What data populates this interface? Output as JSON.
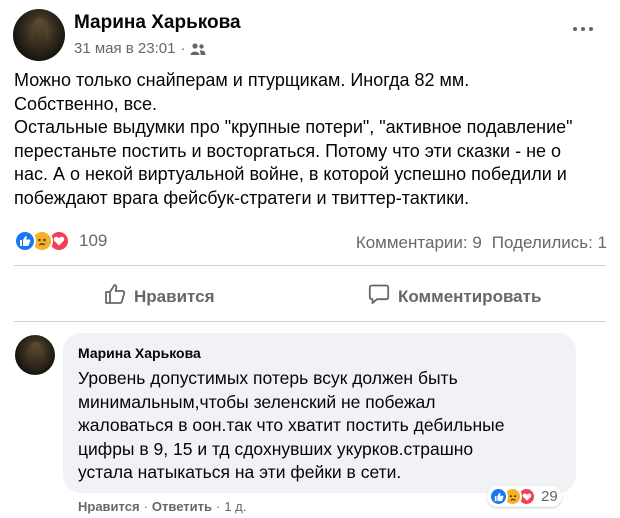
{
  "post": {
    "author": "Марина Харькова",
    "date": "31 мая в 23:01",
    "separator": "·",
    "audience_icon": "friends-icon",
    "text_lines": [
      "Можно только снайперам и птурщикам. Иногда 82 мм.",
      "Собственно, все.",
      "Остальные выдумки про \"крупные потери\", \"активное подавление\"",
      "перестаньте постить и восторгаться. Потому что эти сказки - не о",
      "нас. А о некой виртуальной войне, в которой успешно победили и",
      "побеждают врага фейсбук-стратеги и твиттер-тактики."
    ],
    "reactions": {
      "icons": [
        "like-icon",
        "sad-icon",
        "love-icon"
      ],
      "count": "109"
    },
    "comments_label": "Комментарии: 9",
    "shares_label": "Поделились: 1",
    "like_label": "Нравится",
    "comment_label": "Комментировать"
  },
  "comment": {
    "author": "Марина Харькова",
    "text_lines": [
      "Уровень допустимых потерь всук должен быть",
      "минимальным,чтобы зеленский не побежал",
      "жаловаться в оон.так что хватит постить дебильные",
      "цифры в 9, 15 и тд сдохнувших укурков.страшно",
      "устала натыкаться на эти фейки в сети."
    ],
    "reactions": {
      "icons": [
        "like-icon",
        "sad-icon",
        "love-icon"
      ],
      "count": "29"
    },
    "like_label": "Нравится",
    "separator": "·",
    "reply_label": "Ответить",
    "age": "1 д."
  },
  "colors": {
    "like": "#1877f2",
    "sad": "#f7b125",
    "love": "#f33e58",
    "secondary_text": "#65676b",
    "bubble": "#f0f2f5"
  }
}
